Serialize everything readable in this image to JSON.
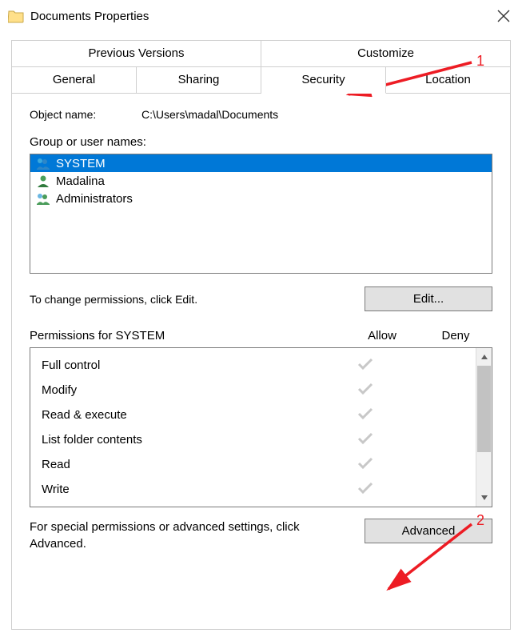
{
  "window": {
    "title": "Documents Properties"
  },
  "tabs": {
    "row1": [
      "Previous Versions",
      "Customize"
    ],
    "row2": [
      "General",
      "Sharing",
      "Security",
      "Location"
    ],
    "active": "Security"
  },
  "object_name": {
    "label": "Object name:",
    "value": "C:\\Users\\madal\\Documents"
  },
  "groups": {
    "label": "Group or user names:",
    "items": [
      {
        "name": "SYSTEM",
        "icon": "users",
        "selected": true
      },
      {
        "name": "Madalina",
        "icon": "user",
        "selected": false
      },
      {
        "name": "Administrators",
        "icon": "users",
        "selected": false
      }
    ]
  },
  "edit": {
    "text": "To change permissions, click Edit.",
    "button": "Edit..."
  },
  "permissions": {
    "header_label": "Permissions for SYSTEM",
    "columns": {
      "allow": "Allow",
      "deny": "Deny"
    },
    "rows": [
      {
        "name": "Full control",
        "allow": true,
        "deny": false
      },
      {
        "name": "Modify",
        "allow": true,
        "deny": false
      },
      {
        "name": "Read & execute",
        "allow": true,
        "deny": false
      },
      {
        "name": "List folder contents",
        "allow": true,
        "deny": false
      },
      {
        "name": "Read",
        "allow": true,
        "deny": false
      },
      {
        "name": "Write",
        "allow": true,
        "deny": false
      }
    ]
  },
  "advanced": {
    "text": "For special permissions or advanced settings, click Advanced.",
    "button": "Advanced"
  },
  "annotations": {
    "one": "1",
    "two": "2"
  }
}
